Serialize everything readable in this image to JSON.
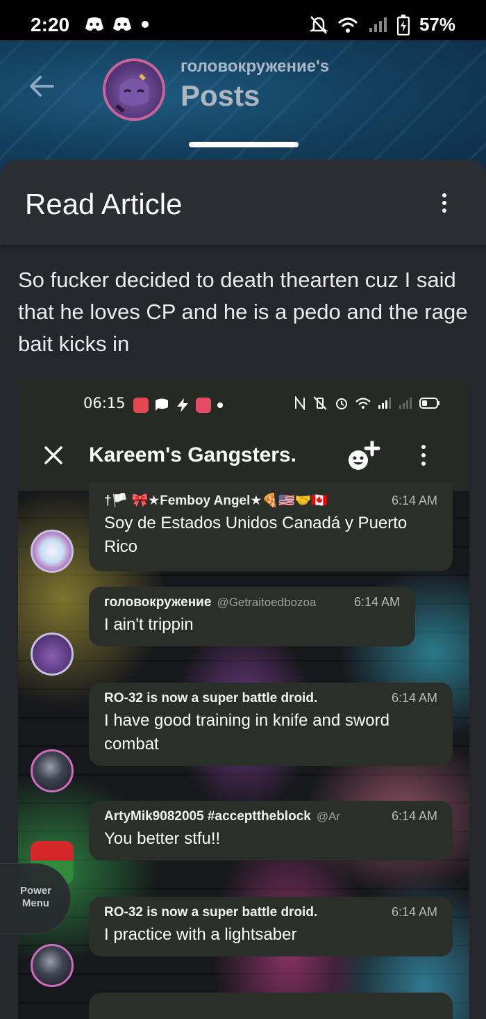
{
  "status_bar": {
    "time": "2:20",
    "battery": "57%",
    "icons": [
      "discord-icon",
      "discord-icon",
      "dot-icon",
      "mute-icon",
      "wifi-icon",
      "signal-icon",
      "battery-charging-icon"
    ]
  },
  "header": {
    "subtitle": "головокружение's",
    "title": "Posts"
  },
  "sheet": {
    "title": "Read Article",
    "body": "So fucker decided to death thearten cuz I said that he loves CP and he is a pedo and the rage bait kicks in"
  },
  "embedded": {
    "status_time": "06:15",
    "chat_title": "Kareem's Gangsters.",
    "messages": [
      {
        "name": "†🏳️ 🎀★Femboy Angel★🍕🇺🇸🤝🇨🇦",
        "handle": "",
        "time": "6:14 AM",
        "text": "Soy de Estados Unidos Canadá y Puerto Rico"
      },
      {
        "name": "головокружение",
        "handle": "@Getraitoedbozoa",
        "time": "6:14 AM",
        "text": "I ain't trippin"
      },
      {
        "name": "RO-32 is now a super battle droid.",
        "handle": "",
        "time": "6:14 AM",
        "text": "I have good training in knife and sword combat"
      },
      {
        "name": "ArtyMik9082005 #accepttheblock",
        "handle": "@Ar",
        "time": "6:14 AM",
        "text": "You better stfu!!"
      },
      {
        "name": "RO-32 is now a super battle droid.",
        "handle": "",
        "time": "6:14 AM",
        "text": "I practice with a lightsaber"
      }
    ]
  },
  "power_menu": {
    "label_line1": "Power",
    "label_line2": "Menu"
  },
  "colors": {
    "sheet_bg": "#25272c",
    "bubble_bg": "#2a2f2a",
    "header_blue": "#13405e",
    "avatar_ring": "#c7649a"
  }
}
